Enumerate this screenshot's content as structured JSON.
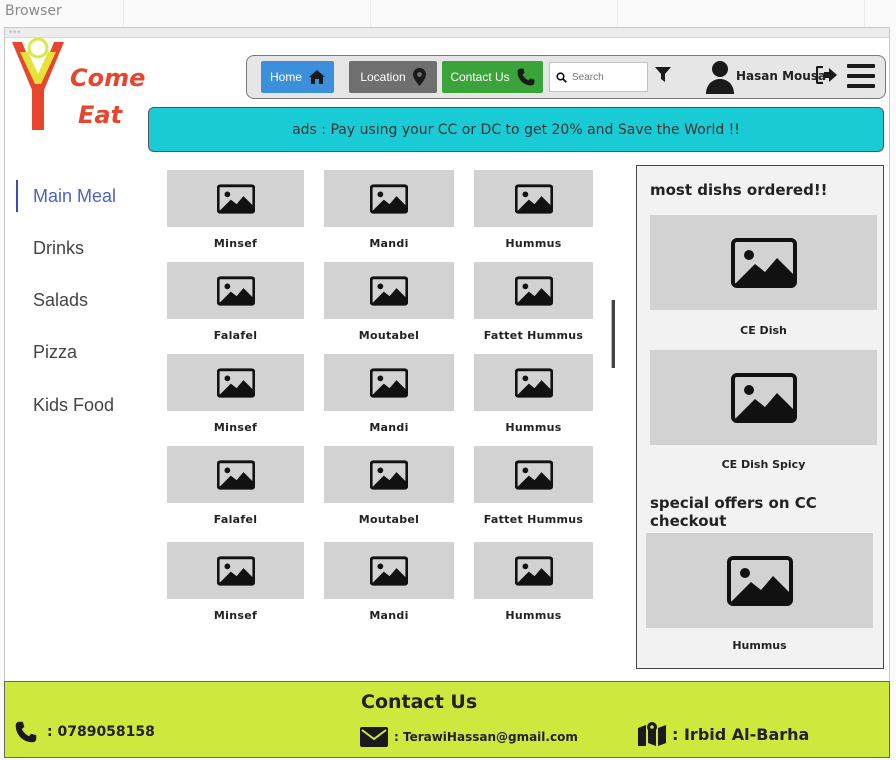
{
  "browser": {
    "title": "Browser"
  },
  "logo": {
    "line1": "Come",
    "line2": "Eat"
  },
  "navbar": {
    "home_label": "Home",
    "location_label": "Location",
    "contact_label": "Contact Us",
    "search_placeholder": "Search",
    "user_name": "Hasan Mousa"
  },
  "ads": {
    "text": "ads : Pay using your CC or DC to get 20% and Save the World !!"
  },
  "sidebar": {
    "items": [
      {
        "label": "Main Meal",
        "active": true
      },
      {
        "label": "Drinks",
        "active": false
      },
      {
        "label": "Salads",
        "active": false
      },
      {
        "label": "Pizza",
        "active": false
      },
      {
        "label": "Kids Food",
        "active": false
      }
    ]
  },
  "grid": {
    "rows": [
      [
        "Minsef",
        "Mandi",
        "Hummus"
      ],
      [
        "Falafel",
        "Moutabel",
        "Fattet Hummus"
      ],
      [
        "Minsef",
        "Mandi",
        "Hummus"
      ],
      [
        "Falafel",
        "Moutabel",
        "Fattet Hummus"
      ],
      [
        "Minsef",
        "Mandi",
        "Hummus"
      ]
    ]
  },
  "right_panel": {
    "most_ordered_heading": "most dishs ordered!!",
    "most_ordered": [
      "CE Dish",
      "CE Dish  Spicy"
    ],
    "special_heading": "special offers on CC checkout",
    "special": [
      "Hummus"
    ]
  },
  "footer": {
    "title": "Contact Us",
    "phone": ": 0789058158",
    "email": ": TerawiHassan@gmail.com",
    "address": ": Irbid Al-Barha"
  },
  "colors": {
    "home": "#3b8fdb",
    "location": "#6f6f6f",
    "contact": "#3aa33a",
    "ads_bg": "#19cbd4",
    "footer_bg": "#cfe83e",
    "logo": "#e8452c",
    "sidebar_active": "#4a62c7"
  }
}
